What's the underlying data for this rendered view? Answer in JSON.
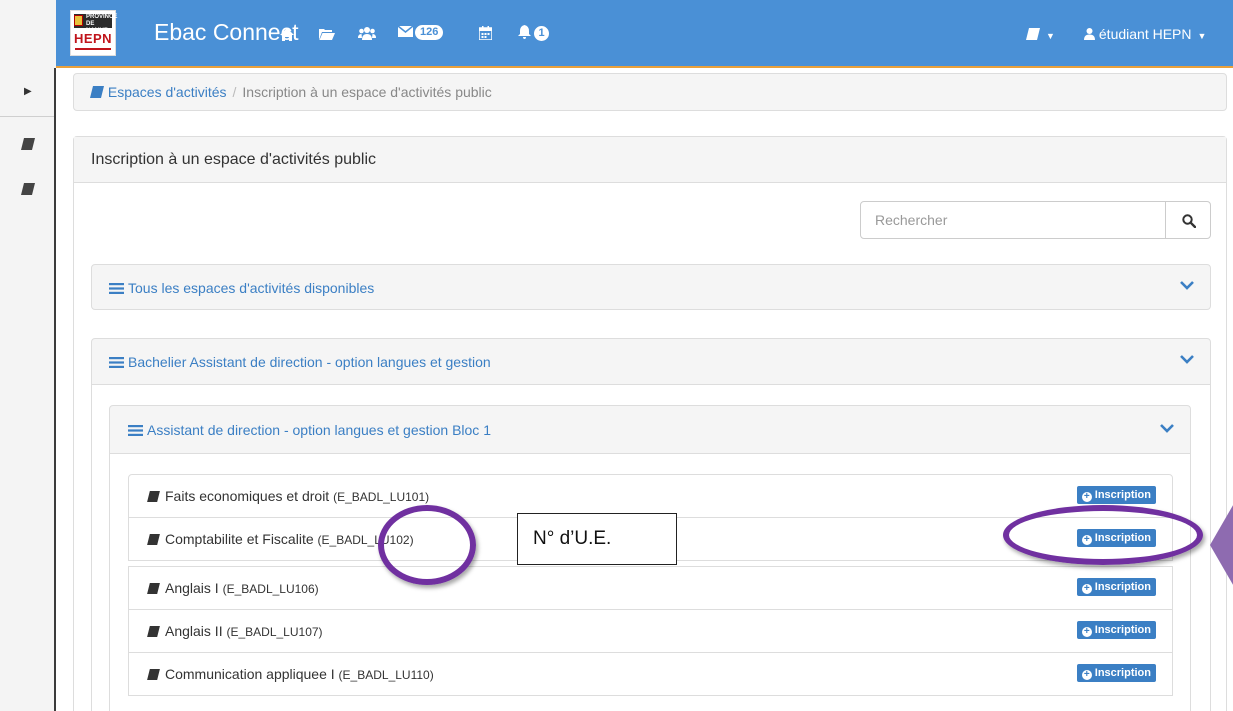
{
  "navbar": {
    "logo_top_text": "PROVINCE DE NAMUR",
    "logo_text": "HEPN",
    "brand": "Ebac Connect",
    "messages_count": "126",
    "notifications_count": "1",
    "user_label": "étudiant HEPN"
  },
  "breadcrumb": {
    "root": "Espaces d'activités",
    "separator": "/",
    "current": "Inscription à un espace d'activités public"
  },
  "panel": {
    "title": "Inscription à un espace d'activités public"
  },
  "search": {
    "placeholder": "Rechercher"
  },
  "sections": {
    "all": "Tous les espaces d'activités disponibles",
    "bachelor": "Bachelier Assistant de direction - option langues et gestion",
    "bloc": "Assistant de direction - option langues et gestion Bloc 1"
  },
  "courses": [
    {
      "name": "Faits economiques et droit",
      "code": "(E_BADL_LU101)",
      "button": "Inscription"
    },
    {
      "name": "Comptabilite et Fiscalite",
      "code": "(E_BADL_LU102)",
      "button": "Inscription"
    },
    {
      "name": "Anglais I",
      "code": "(E_BADL_LU106)",
      "button": "Inscription"
    },
    {
      "name": "Anglais II",
      "code": "(E_BADL_LU107)",
      "button": "Inscription"
    },
    {
      "name": "Communication appliquee I",
      "code": "(E_BADL_LU110)",
      "button": "Inscription"
    }
  ],
  "annotation": {
    "callout_text": "N° d’U.E."
  },
  "colors": {
    "navbar": "#4a90d6",
    "navbar_border": "#e9a03b",
    "link": "#3b7fc4",
    "annotation_ring": "#7030a0"
  },
  "icons": [
    "home-icon",
    "folder-open-icon",
    "users-icon",
    "envelope-icon",
    "calendar-icon",
    "bell-icon",
    "book-icon",
    "user-icon",
    "search-icon",
    "chevron-down-icon",
    "hamburger-icon",
    "plus-circle-icon",
    "caret-right-icon"
  ]
}
